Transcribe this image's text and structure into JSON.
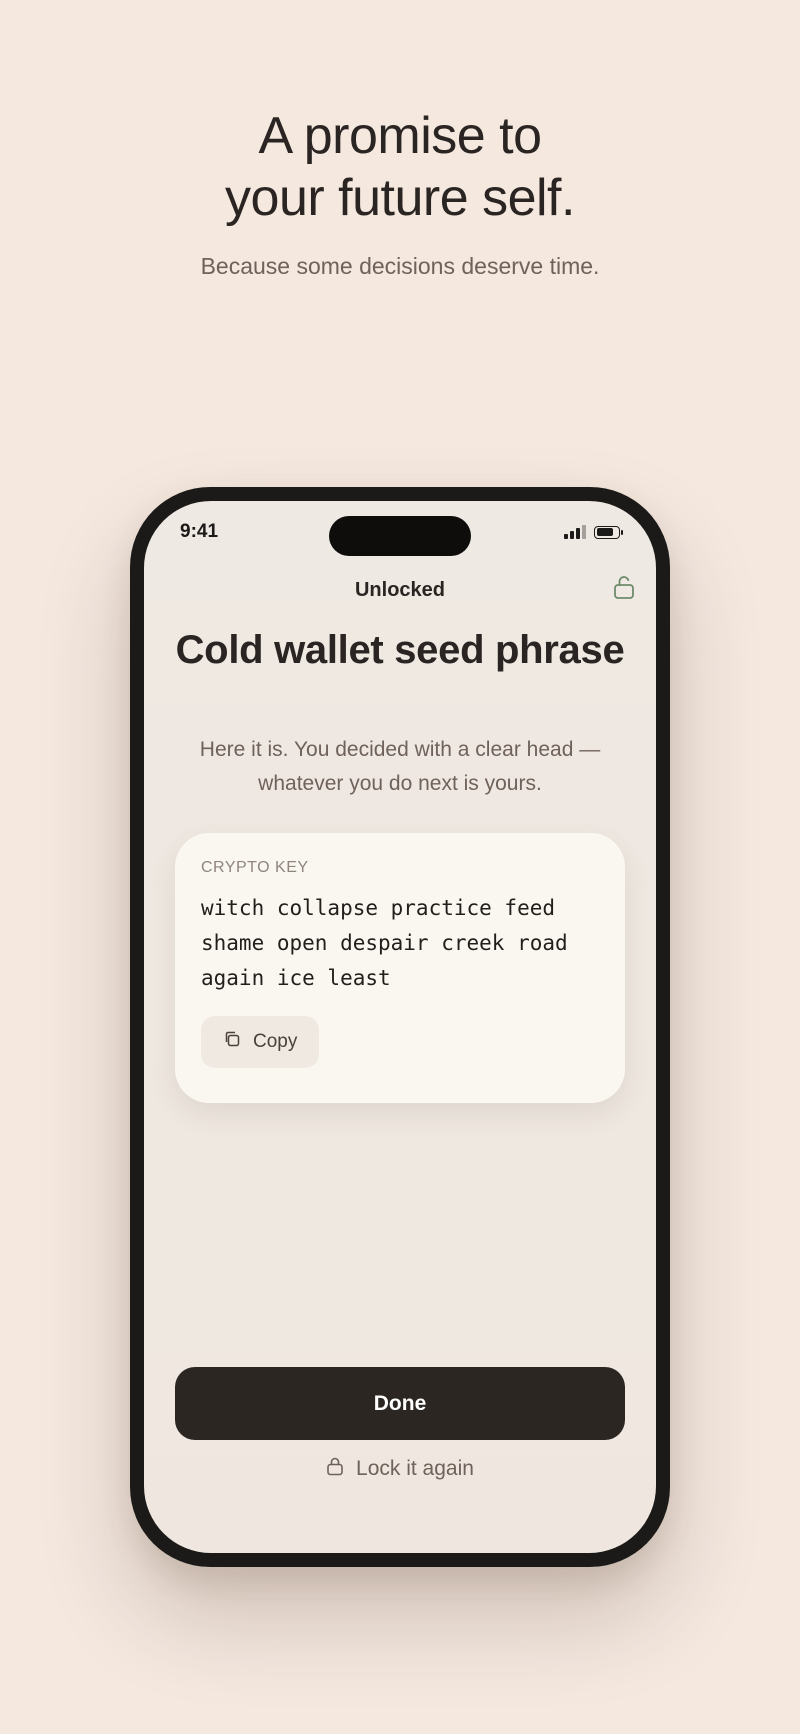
{
  "hero": {
    "title_line1": "A promise to",
    "title_line2": "your future self.",
    "subtitle": "Because some decisions deserve time."
  },
  "status_bar": {
    "time": "9:41",
    "signal_icon": "cellular-signal-icon",
    "battery_icon": "battery-icon",
    "battery_level": 0.8
  },
  "nav": {
    "title": "Unlocked",
    "status_icon": "lock-open-icon"
  },
  "content": {
    "title": "Cold wallet seed phrase",
    "subtitle": "Here it is. You decided with a clear head — whatever you do next is yours."
  },
  "secret_card": {
    "label": "CRYPTO KEY",
    "seed_line1": "witch collapse practice feed",
    "seed_line2": "shame open despair creek road",
    "seed_line3": "again ice least",
    "copy_label": "Copy",
    "copy_icon": "copy-icon"
  },
  "actions": {
    "done_label": "Done",
    "relock_label": "Lock it again",
    "relock_icon": "lock-icon"
  },
  "colors": {
    "background": "#f4e8df",
    "primary_button": "#2b2622",
    "accent_green": "#6e8a6c"
  }
}
